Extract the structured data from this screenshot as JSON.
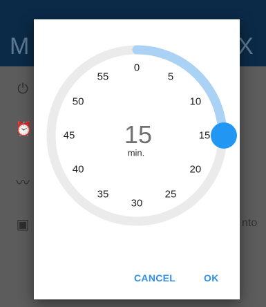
{
  "background": {
    "toolbar_left_letter": "M",
    "toolbar_right_letter": "X",
    "right_text": "nto"
  },
  "picker": {
    "selected_value": "15",
    "unit": "min.",
    "selected_minute": 15,
    "minutes": [
      "0",
      "5",
      "10",
      "15",
      "20",
      "25",
      "30",
      "35",
      "40",
      "45",
      "50",
      "55"
    ],
    "cancel_label": "CANCEL",
    "ok_label": "OK"
  },
  "colors": {
    "accent": "#2196F3",
    "arc": "#A9D2F5",
    "ring": "#EBEBEB"
  }
}
